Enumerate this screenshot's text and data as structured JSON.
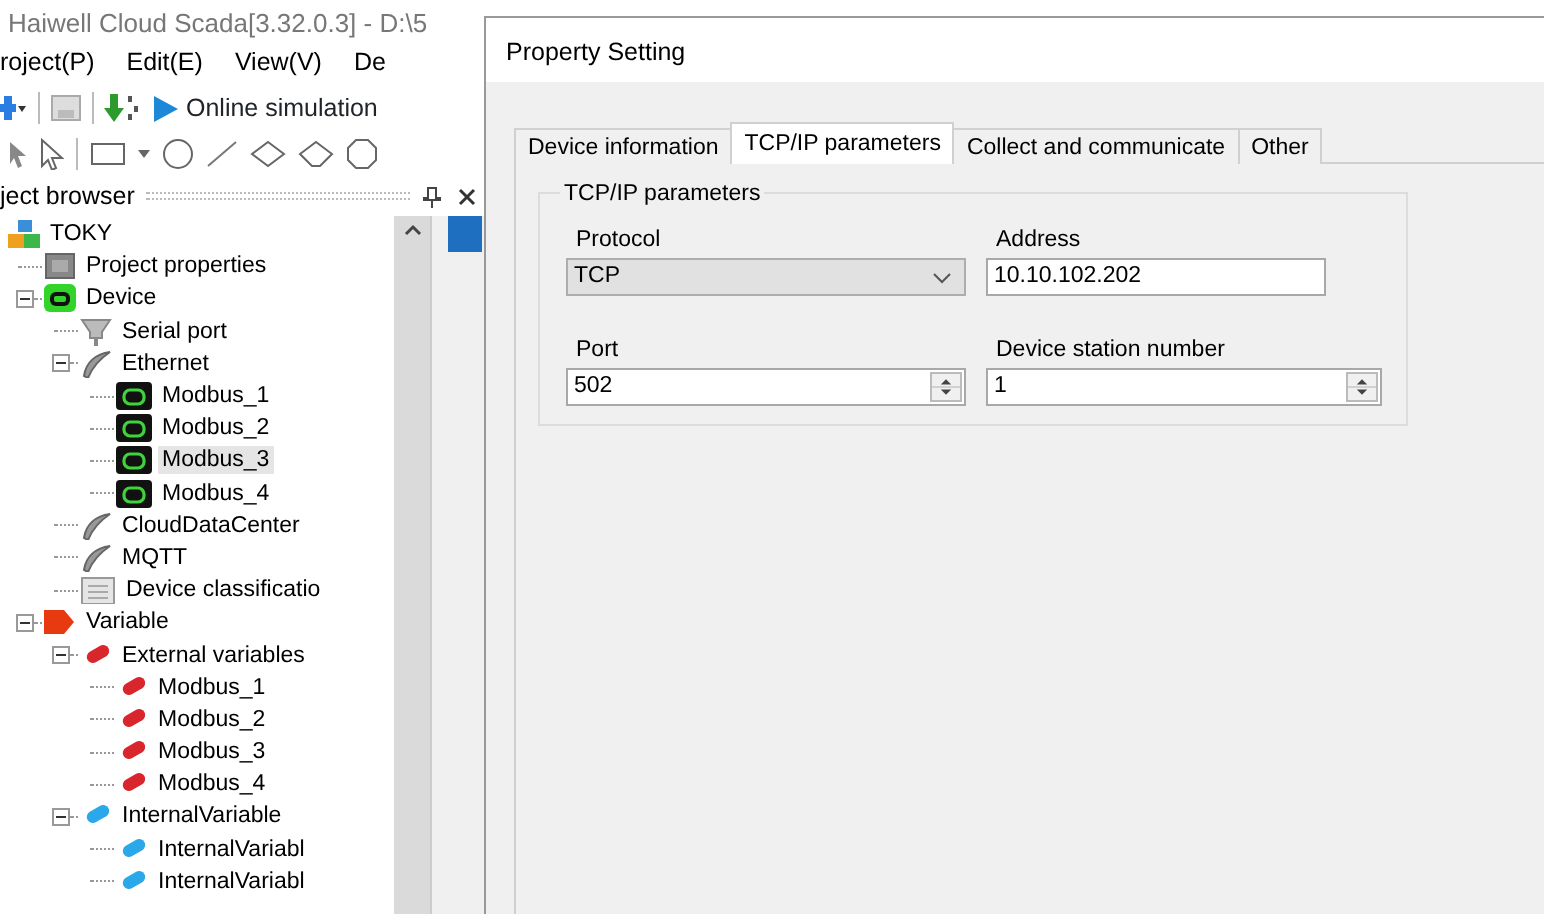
{
  "app": {
    "title": "Haiwell Cloud Scada[3.32.0.3] - D:\\5",
    "menu": [
      "roject(P)",
      "Edit(E)",
      "View(V)",
      "De"
    ],
    "toolbar": {
      "simulation_label": "Online simulation"
    },
    "project_browser": {
      "title": "ject browser",
      "tree": [
        {
          "label": "TOKY",
          "kind": "project",
          "selected": false,
          "children": [
            {
              "label": "Project properties",
              "kind": "properties",
              "selected": false
            },
            {
              "label": "Device",
              "kind": "device",
              "expanded": true,
              "selected": false,
              "children": [
                {
                  "label": "Serial port",
                  "kind": "serial",
                  "selected": false
                },
                {
                  "label": "Ethernet",
                  "kind": "network",
                  "expanded": true,
                  "selected": false,
                  "children": [
                    {
                      "label": "Modbus_1",
                      "kind": "modbus",
                      "selected": false
                    },
                    {
                      "label": "Modbus_2",
                      "kind": "modbus",
                      "selected": false
                    },
                    {
                      "label": "Modbus_3",
                      "kind": "modbus",
                      "selected": true
                    },
                    {
                      "label": "Modbus_4",
                      "kind": "modbus",
                      "selected": false
                    }
                  ]
                },
                {
                  "label": "CloudDataCenter",
                  "kind": "network",
                  "selected": false
                },
                {
                  "label": "MQTT",
                  "kind": "network",
                  "selected": false
                },
                {
                  "label": "Device classificatio",
                  "kind": "classification",
                  "selected": false
                }
              ]
            },
            {
              "label": "Variable",
              "kind": "variable",
              "expanded": true,
              "selected": false,
              "children": [
                {
                  "label": "External variables",
                  "kind": "external",
                  "expanded": true,
                  "selected": false,
                  "children": [
                    {
                      "label": "Modbus_1",
                      "kind": "external",
                      "selected": false
                    },
                    {
                      "label": "Modbus_2",
                      "kind": "external",
                      "selected": false
                    },
                    {
                      "label": "Modbus_3",
                      "kind": "external",
                      "selected": false
                    },
                    {
                      "label": "Modbus_4",
                      "kind": "external",
                      "selected": false
                    }
                  ]
                },
                {
                  "label": "InternalVariable",
                  "kind": "internal",
                  "expanded": true,
                  "selected": false,
                  "children": [
                    {
                      "label": "InternalVariabl",
                      "kind": "internal",
                      "selected": false
                    },
                    {
                      "label": "InternalVariabl",
                      "kind": "internal",
                      "selected": false
                    }
                  ]
                }
              ]
            }
          ]
        }
      ]
    }
  },
  "dialog": {
    "title": "Property Setting",
    "tabs": [
      {
        "label": "Device information",
        "selected": false
      },
      {
        "label": "TCP/IP parameters",
        "selected": true
      },
      {
        "label": "Collect and communicate",
        "selected": false
      },
      {
        "label": "Other",
        "selected": false
      }
    ],
    "group": {
      "title": "TCP/IP parameters",
      "fields": [
        {
          "label": "Protocol",
          "kind": "select",
          "value": "TCP"
        },
        {
          "label": "Address",
          "kind": "text",
          "value": "10.10.102.202"
        },
        {
          "label": "Port",
          "kind": "spin",
          "value": "502"
        },
        {
          "label": "Device station number",
          "kind": "spin",
          "value": "1"
        }
      ]
    }
  }
}
